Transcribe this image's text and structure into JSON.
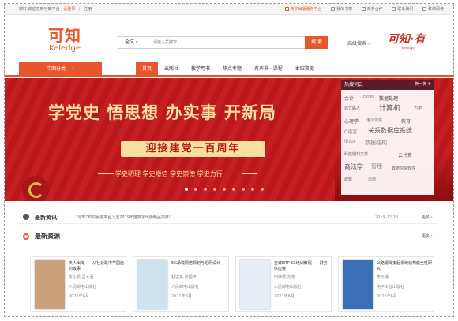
{
  "topbar": {
    "welcome": "您好,欢迎来到可知平台",
    "login": "请登录",
    "register": "注册",
    "links": [
      {
        "label": "数字出版服务平台",
        "highlight": true
      },
      {
        "label": "我的书架",
        "highlight": false
      },
      {
        "label": "商务合作",
        "highlight": false
      },
      {
        "label": "联系我们",
        "highlight": false
      },
      {
        "label": "移动阅读",
        "highlight": false
      }
    ]
  },
  "logo": {
    "cn": "可知",
    "en": "Keledge"
  },
  "search": {
    "scope": "全文",
    "placeholder": "请输入关键字",
    "button": "搜 索",
    "advanced": "高级搜索 ›"
  },
  "partner_logo": {
    "cn": "可知·有",
    "sub": "keledge"
  },
  "nav": {
    "category_label": "中图分类",
    "category_arrow": "›",
    "items": [
      {
        "label": "首页",
        "active": true
      },
      {
        "label": "出版社",
        "active": false
      },
      {
        "label": "教学用书",
        "active": false
      },
      {
        "label": "热点专题",
        "active": false
      },
      {
        "label": "有声书 · 课程",
        "active": false
      },
      {
        "label": "本馆资源",
        "active": false
      }
    ]
  },
  "banner": {
    "headline": "学党史 悟思想 办实事 开新局",
    "subline": "迎接建党一百周年",
    "slogan": "学史明理 学史增信 学史崇德 学史力行",
    "slide_count": 9,
    "active_slide": 0
  },
  "hotwords": {
    "title": "热搜词云",
    "refresh": "换一换 ↻",
    "words": [
      {
        "text": "会计",
        "size": 6,
        "color": "#666"
      },
      {
        "text": "Excel",
        "size": 5,
        "color": "#888"
      },
      {
        "text": "数据处理",
        "size": 6,
        "color": "#444"
      },
      {
        "text": "逃亡路人",
        "size": 5,
        "color": "#666"
      },
      {
        "text": "计算机",
        "size": 9,
        "color": "#555"
      },
      {
        "text": "心理学",
        "size": 6,
        "color": "#555"
      },
      {
        "text": "诺贝尔奖",
        "size": 5,
        "color": "#777"
      },
      {
        "text": "教育",
        "size": 6,
        "color": "#666"
      },
      {
        "text": "C语言",
        "size": 6,
        "color": "#777"
      },
      {
        "text": "关系数据库系统",
        "size": 8,
        "color": "#555"
      },
      {
        "text": "linux",
        "size": 6,
        "color": "#888"
      },
      {
        "text": "数据结构",
        "size": 7,
        "color": "#888"
      },
      {
        "text": "科技期刊文学",
        "size": 5,
        "color": "#666"
      },
      {
        "text": "云计算",
        "size": 6,
        "color": "#666"
      },
      {
        "text": "商法学",
        "size": 8,
        "color": "#555"
      },
      {
        "text": "管理",
        "size": 7,
        "color": "#888"
      },
      {
        "text": "数据挖掘软件",
        "size": 5,
        "color": "#666"
      },
      {
        "text": "建筑",
        "size": 5,
        "color": "#666"
      },
      {
        "text": "运动",
        "size": 5,
        "color": "#777"
      },
      {
        "text": "力学",
        "size": 5,
        "color": "#666"
      }
    ]
  },
  "news": {
    "label": "最新资讯:",
    "text": "“可知”知识服务平台入选2019年度数字出版精品项目!",
    "date": "2019-12-13",
    "more": "更多 ›"
  },
  "latest": {
    "label": "最新资源",
    "more": "更多 ›",
    "cards": [
      {
        "title": "美人出海——从社会路中学国画的故事",
        "author": "陈小凯,吕大夏",
        "publisher": "人民邮电出版社",
        "date": "2021年6月",
        "cover": "#c9a27d"
      },
      {
        "title": "5G承载网络规划与组网设计",
        "author": "杜宝来,帅国祥",
        "publisher": "人民邮电出版社",
        "date": "2021年6月",
        "cover": "#cfe3ef"
      },
      {
        "title": "金蝶ERP-K3培训教程——财务供应链",
        "author": "田维霞,刘芳",
        "publisher": "人民邮电出版社",
        "date": "2021年6月",
        "cover": "#e8eef5"
      },
      {
        "title": "公路钢绳支起系统结构健全性研究",
        "author": "李元通",
        "publisher": "电子工业出版社",
        "date": "2021年6月",
        "cover": "#3c6fb8"
      }
    ]
  }
}
